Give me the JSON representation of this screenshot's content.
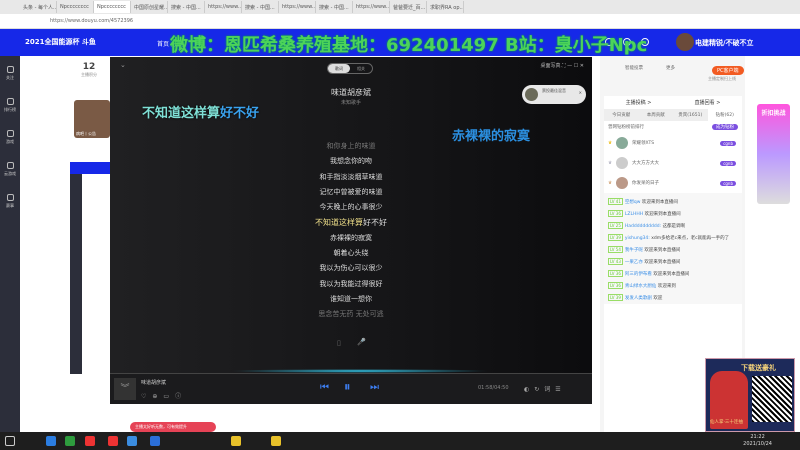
{
  "browser": {
    "tabs": [
      "头条 - 每个人...",
      "Npcccccccc",
      "Npcccccccc",
      "中国原创星耀...",
      "搜索 - 中国...",
      "https://www...",
      "搜索 - 中国...",
      "https://www...",
      "搜索 - 中国...",
      "https://www...",
      "爸爸要迁_百...",
      "求职界RA op..."
    ],
    "url": "https://www.douyu.com/4572396"
  },
  "site": {
    "logo": "2021全国能源杯 斗鱼",
    "nav": "首页  分类",
    "watermark": "微博：恩匹希桑养殖基地：692401497 B站：臭小子Npc",
    "user": "电建精锐/不破不立"
  },
  "left_sidebar": [
    "关注",
    "排行榜",
    "游戏",
    "云游戏",
    "赛事"
  ],
  "anchor": {
    "count": "12",
    "label": "主播积分",
    "name": "病吧丨公告"
  },
  "player": {
    "toggle": [
      "歌词",
      "相关"
    ],
    "title": "味道胡彦斌",
    "singer": "未知歌手",
    "desk_lyric_left_sung": "不知道这样算",
    "desk_lyric_left_rest": "好不好",
    "desk_lyric_right": "赤裸裸的寂寞",
    "popup": "票投最佳混音",
    "window_controls": "桌面写真  ⛶ — ☐ ✕",
    "lyrics": [
      "和你身上的味道",
      "我想念你的吻",
      "和手指淡淡烟草味道",
      "记忆中曾被爱的味道",
      "今天晚上的心事很少",
      "不知道这样算好不好",
      "赤裸裸的寂寞",
      "朝着心头绕",
      "我以为伤心可以很少",
      "我以为我能过得很好",
      "谁知道一想你",
      "思念苦无药 无处可逃"
    ],
    "current_sung": "不知道这样算",
    "current_rest": "好不好",
    "now_playing": "味道胡彦斌",
    "time": "01:58/04:50"
  },
  "right_panel": {
    "actions": [
      "智能投票",
      "更多"
    ],
    "pc_button": "PC客户端",
    "pc_sub": "主播定制扫上线",
    "headers": [
      "主播投稿 >",
      "直播回看 >"
    ],
    "tabs": [
      "今日贡献",
      "本周贡献",
      "贵宾(1651)",
      "钻粉(62)"
    ],
    "fan_rank_label": "曾网钻粉榜前排行",
    "fan_button": "成为钻粉",
    "ranks": [
      {
        "name": "荣耀领XTS",
        "badge": "cgnb"
      },
      {
        "name": "大大方方大大",
        "badge": "cgnb"
      },
      {
        "name": "你发呆的日子",
        "badge": "cgnb"
      }
    ],
    "chat": [
      {
        "lv": "LV 41",
        "name": "空想qw",
        "text": "欢迎来到本直播间"
      },
      {
        "lv": "LV 36",
        "name": "LZLHHH",
        "text": "欢迎来到本直播间"
      },
      {
        "lv": "LV 25",
        "name": "Hadddddddddd:",
        "text": "这都是调啊"
      },
      {
        "lv": "LV 39",
        "name": "yishung34:",
        "text": "xdm多给老c来点，老c就能再一手的了"
      },
      {
        "lv": "LV 54",
        "name": "我牛子呢",
        "text": "欢迎来到本直播间"
      },
      {
        "lv": "LV 43",
        "name": "一果乙亦",
        "text": "欢迎来到本直播间"
      },
      {
        "lv": "LV 36",
        "name": "阿三的伊布看",
        "text": "欢迎来到本直播间"
      },
      {
        "lv": "LV 36",
        "name": "青山绿水大厨仙",
        "text": "欢迎来到"
      },
      {
        "lv": "LV 39",
        "name": "发发人类歌剧",
        "text": "欢迎"
      }
    ]
  },
  "ads": {
    "side": "折扣挑战",
    "bottom_title": "下载送豪礼",
    "bottom_sub": "仙人掌·三十连抽"
  },
  "toast": "主播太好听无数，可有效提升",
  "clock": {
    "time": "21:22",
    "date": "2021/10/24"
  },
  "colors": {
    "douyu_blue": "#1628e8",
    "watermark_green": "#4cd35a",
    "player_accent": "#3d7ef0"
  }
}
